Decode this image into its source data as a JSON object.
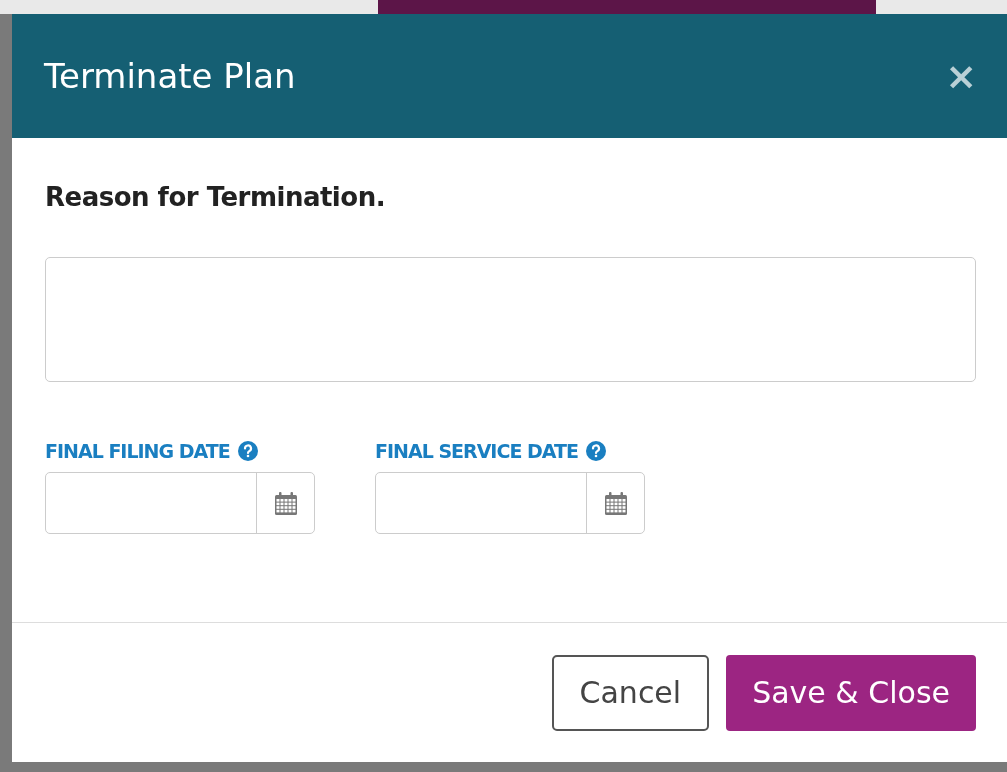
{
  "modal": {
    "title": "Terminate Plan",
    "close": "×"
  },
  "reason": {
    "label": "Reason for Termination."
  },
  "date_fields": [
    {
      "label": "FINAL FILING DATE"
    },
    {
      "label": "FINAL SERVICE DATE"
    }
  ],
  "buttons": [
    {
      "label": "Cancel",
      "kind": "secondary"
    },
    {
      "label": "Save & Close",
      "kind": "primary"
    }
  ]
}
